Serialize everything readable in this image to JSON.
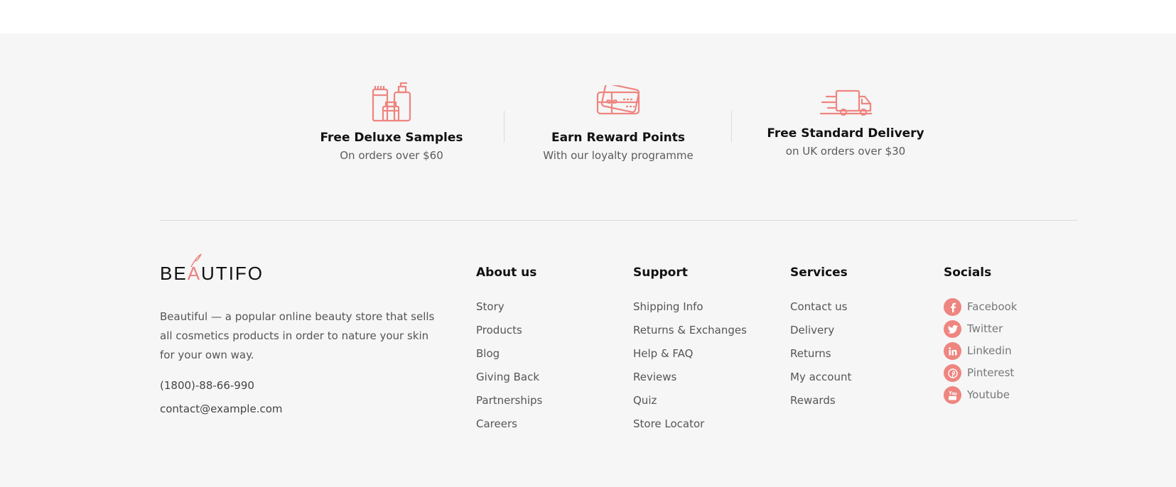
{
  "features": [
    {
      "icon": "cosmetics-bottles-icon",
      "title": "Free Deluxe Samples",
      "subtitle": "On orders over $60"
    },
    {
      "icon": "gift-card-icon",
      "title": "Earn Reward Points",
      "subtitle": "With our loyalty programme"
    },
    {
      "icon": "delivery-truck-icon",
      "title": "Free Standard Delivery",
      "subtitle": "on UK orders over $30"
    }
  ],
  "brand": {
    "logo_pre": "BE",
    "logo_accent": "A",
    "logo_post": "UTIFO",
    "description": "Beautiful — a popular online beauty store that sells all cosmetics products in order to nature your skin for your own way.",
    "phone": "(1800)-88-66-990",
    "email": "contact@example.com"
  },
  "columns": [
    {
      "title": "About us",
      "items": [
        "Story",
        "Products",
        "Blog",
        "Giving Back",
        "Partnerships",
        "Careers"
      ]
    },
    {
      "title": "Support",
      "items": [
        "Shipping Info",
        "Returns & Exchanges",
        "Help & FAQ",
        "Reviews",
        "Quiz",
        "Store Locator"
      ]
    },
    {
      "title": "Services",
      "items": [
        "Contact us",
        "Delivery",
        "Returns",
        "My account",
        "Rewards"
      ]
    }
  ],
  "socials": {
    "title": "Socials",
    "items": [
      {
        "icon": "facebook-icon",
        "label": "Facebook"
      },
      {
        "icon": "twitter-icon",
        "label": "Twitter"
      },
      {
        "icon": "linkedin-icon",
        "label": "Linkedin"
      },
      {
        "icon": "pinterest-icon",
        "label": "Pinterest"
      },
      {
        "icon": "youtube-icon",
        "label": "Youtube"
      }
    ]
  },
  "colors": {
    "accent": "#ee8580",
    "background": "#f6f6f6"
  }
}
